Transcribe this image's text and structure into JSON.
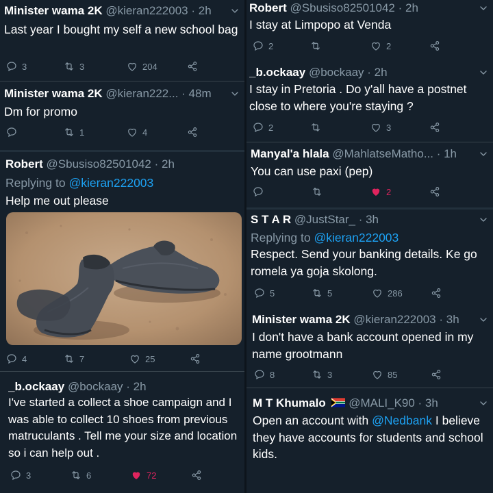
{
  "left": {
    "tweets": [
      {
        "name": "Minister wama 2K",
        "handle": "@kieran222003 · 2h",
        "text": "Last year I bought my self a new school bag",
        "replies": "3",
        "retweets": "3",
        "likes": "204"
      },
      {
        "name": "Minister wama 2K",
        "handle": "@kieran222... · 48m",
        "text": "Dm for promo",
        "replies": "",
        "retweets": "1",
        "likes": "4"
      },
      {
        "name": "Robert",
        "handle": "@Sbusiso82501042 · 2h",
        "replying_prefix": "Replying to",
        "replying_to": "@kieran222003",
        "text": "Help me out please",
        "replies": "4",
        "retweets": "7",
        "likes": "25",
        "image": "worn-out-school-shoes-photo"
      },
      {
        "name": "_b.ockaay",
        "handle": "@bockaay · 2h",
        "text": "I've started a collect a shoe campaign and I was able to collect 10 shoes from previous matruculants . Tell me your size and location so i can help out .",
        "replies": "3",
        "retweets": "6",
        "likes": "72"
      }
    ]
  },
  "right": {
    "tweets": [
      {
        "name": "Robert",
        "handle": "@Sbusiso82501042 · 2h",
        "text": "I stay at Limpopo at Venda",
        "replies": "2",
        "retweets": "",
        "likes": "2"
      },
      {
        "name": "_b.ockaay",
        "handle": "@bockaay · 2h",
        "text": "I stay in Pretoria . Do y'all have a postnet close to where you're staying ?",
        "replies": "2",
        "retweets": "",
        "likes": "3"
      },
      {
        "name": "Manyal'a hlala",
        "handle": "@MahlatseMatho... · 1h",
        "text": "You can use paxi (pep)",
        "replies": "",
        "retweets": "",
        "likes": "2"
      },
      {
        "name": "S T A R",
        "handle": "@JustStar_ · 3h",
        "replying_prefix": "Replying to",
        "replying_to": "@kieran222003",
        "text": "Respect. Send your banking details. Ke go romela ya goja skolong.",
        "replies": "5",
        "retweets": "5",
        "likes": "286"
      },
      {
        "name": "Minister wama 2K",
        "handle": "@kieran222003 · 3h",
        "text": "I don't have a bank account opened in my name grootmann",
        "replies": "8",
        "retweets": "3",
        "likes": "85"
      },
      {
        "name": "M T Khumalo",
        "flag": "south-africa-flag",
        "handle": "@MALI_K90 · 3h",
        "text_before": "Open an account with",
        "mention": "@Nedbank",
        "text_after": "I believe they have accounts for students and school kids."
      }
    ]
  },
  "icons": {
    "reply": "reply-icon",
    "retweet": "retweet-icon",
    "like": "heart-icon",
    "share": "share-icon",
    "caret": "chevron-down-icon"
  },
  "colors": {
    "background": "#15202b",
    "secondary_text": "#8899a6",
    "link": "#1da1f2",
    "like_active": "#e0245e",
    "divider": "#38444d"
  }
}
